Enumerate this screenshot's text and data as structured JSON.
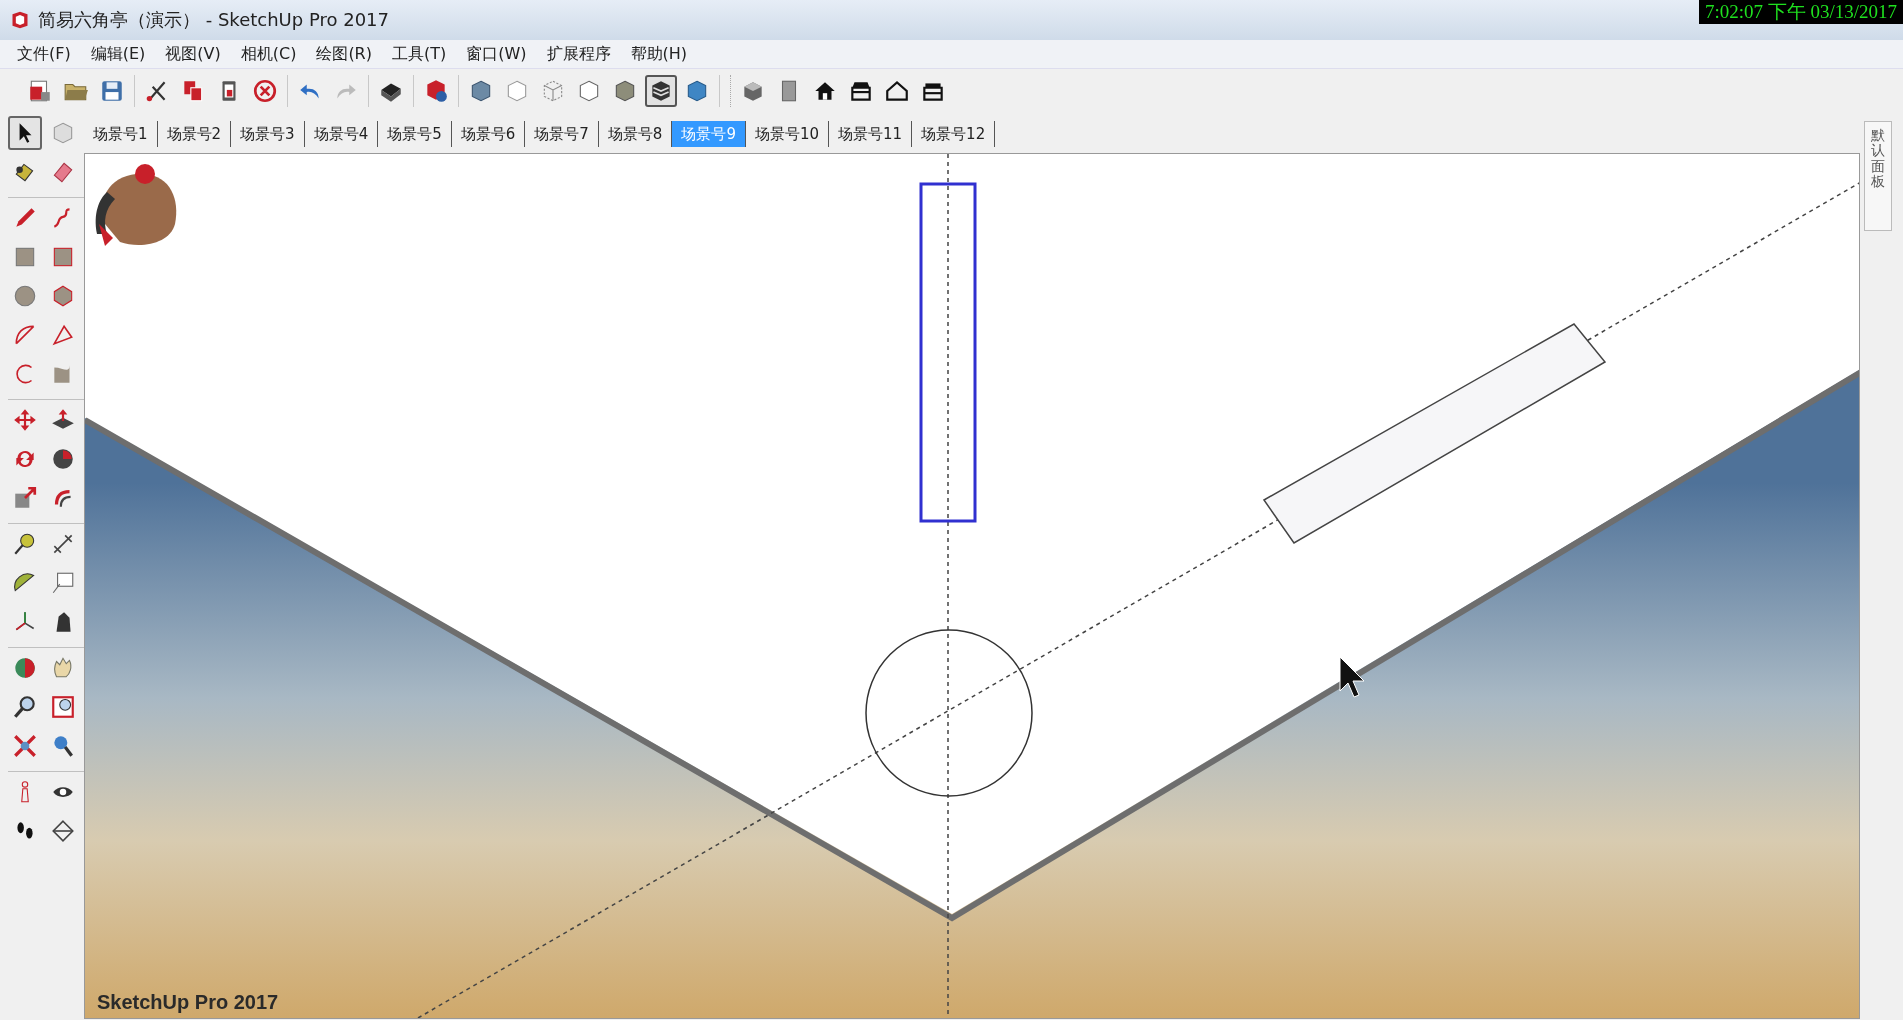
{
  "window": {
    "title": "简易六角亭（演示） - SketchUp Pro 2017"
  },
  "clock_overlay": "7:02:07 下午 03/13/2017",
  "menu": [
    "文件(F)",
    "编辑(E)",
    "视图(V)",
    "相机(C)",
    "绘图(R)",
    "工具(T)",
    "窗口(W)",
    "扩展程序",
    "帮助(H)"
  ],
  "toolbar": [
    {
      "selected": false
    },
    {
      "selected": false
    },
    {
      "selected": false
    },
    {
      "selected": false
    },
    {
      "selected": false
    },
    {
      "selected": false
    },
    {
      "selected": false
    },
    {
      "selected": false
    },
    {
      "selected": false
    },
    {
      "selected": false
    },
    {
      "selected": false
    },
    {
      "selected": false
    },
    {
      "selected": false
    },
    {
      "selected": false
    },
    {
      "selected": false
    },
    {
      "selected": false
    },
    {
      "selected": true
    },
    {
      "selected": false
    },
    {
      "selected": false
    },
    {
      "selected": false
    },
    {
      "selected": false
    },
    {
      "selected": false
    },
    {
      "selected": false
    },
    {
      "selected": false
    }
  ],
  "scenes": [
    {
      "label": "场景号1",
      "selected": false
    },
    {
      "label": "场景号2",
      "selected": false
    },
    {
      "label": "场景号3",
      "selected": false
    },
    {
      "label": "场景号4",
      "selected": false
    },
    {
      "label": "场景号5",
      "selected": false
    },
    {
      "label": "场景号6",
      "selected": false
    },
    {
      "label": "场景号7",
      "selected": false
    },
    {
      "label": "场景号8",
      "selected": false
    },
    {
      "label": "场景号9",
      "selected": true
    },
    {
      "label": "场景号10",
      "selected": false
    },
    {
      "label": "场景号11",
      "selected": false
    },
    {
      "label": "场景号12",
      "selected": false
    }
  ],
  "tools": [
    {
      "selected": true
    },
    {
      "selected": false
    },
    {
      "selected": false
    },
    {
      "selected": false
    },
    {
      "selected": false
    },
    {
      "selected": false
    },
    {
      "selected": false
    },
    {
      "selected": false
    },
    {
      "selected": false
    },
    {
      "selected": false
    },
    {
      "selected": false
    },
    {
      "selected": false
    },
    {
      "selected": false
    },
    {
      "selected": false
    },
    {
      "selected": false
    },
    {
      "selected": false
    },
    {
      "selected": false
    },
    {
      "selected": false
    },
    {
      "selected": false
    },
    {
      "selected": false
    },
    {
      "selected": false
    },
    {
      "selected": false
    },
    {
      "selected": false
    },
    {
      "selected": false
    },
    {
      "selected": false
    },
    {
      "selected": false
    },
    {
      "selected": false
    },
    {
      "selected": false
    },
    {
      "selected": false
    },
    {
      "selected": false
    },
    {
      "selected": false
    },
    {
      "selected": false
    },
    {
      "selected": false
    },
    {
      "selected": false
    },
    {
      "selected": false
    },
    {
      "selected": false
    }
  ],
  "viewport": {
    "model_label": "SketchUp Pro 2017"
  },
  "tray": {
    "tab": "默认面板"
  }
}
